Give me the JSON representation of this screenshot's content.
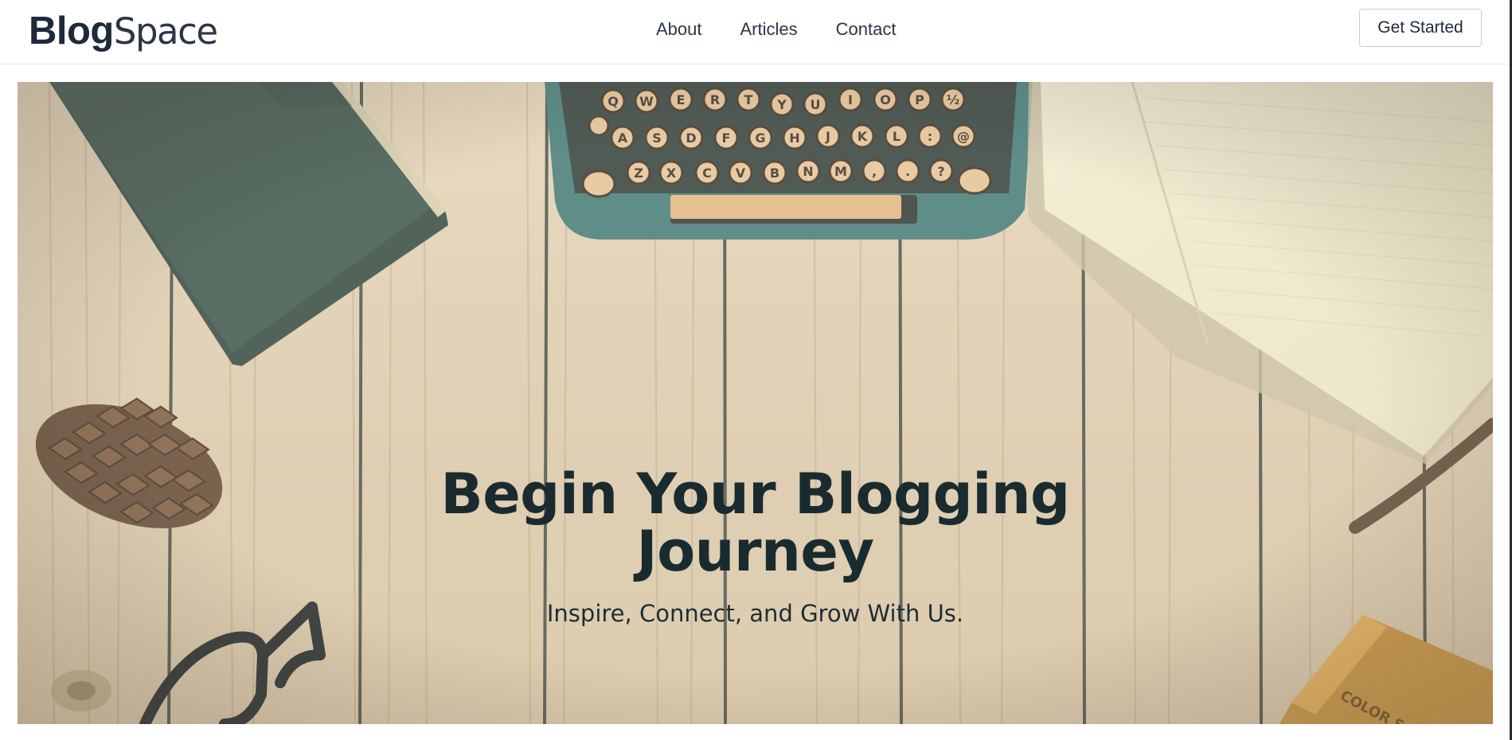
{
  "logo": {
    "bold": "Blog",
    "light": "Space"
  },
  "nav": {
    "items": [
      "About",
      "Articles",
      "Contact"
    ]
  },
  "cta": {
    "label": "Get Started"
  },
  "hero": {
    "title_line1": "Begin Your Blogging",
    "title_line2": "Journey",
    "subtitle": "Inspire, Connect, and Grow With Us.",
    "keys_row1": [
      "Q",
      "W",
      "E",
      "R",
      "T",
      "Y",
      "U",
      "I",
      "O",
      "P",
      "½"
    ],
    "keys_row2": [
      "A",
      "S",
      "D",
      "F",
      "G",
      "H",
      "J",
      "K",
      "L",
      ":",
      "@"
    ],
    "keys_row3": [
      "Z",
      "X",
      "C",
      "V",
      "B",
      "N",
      "M",
      ",",
      ".",
      "?"
    ],
    "box_text": "COLOR S"
  },
  "colors": {
    "wood": "#e2d2b9",
    "typewriter": "#3f7b7b",
    "book": "#364f4a",
    "text_dark": "#1a2b2f"
  }
}
